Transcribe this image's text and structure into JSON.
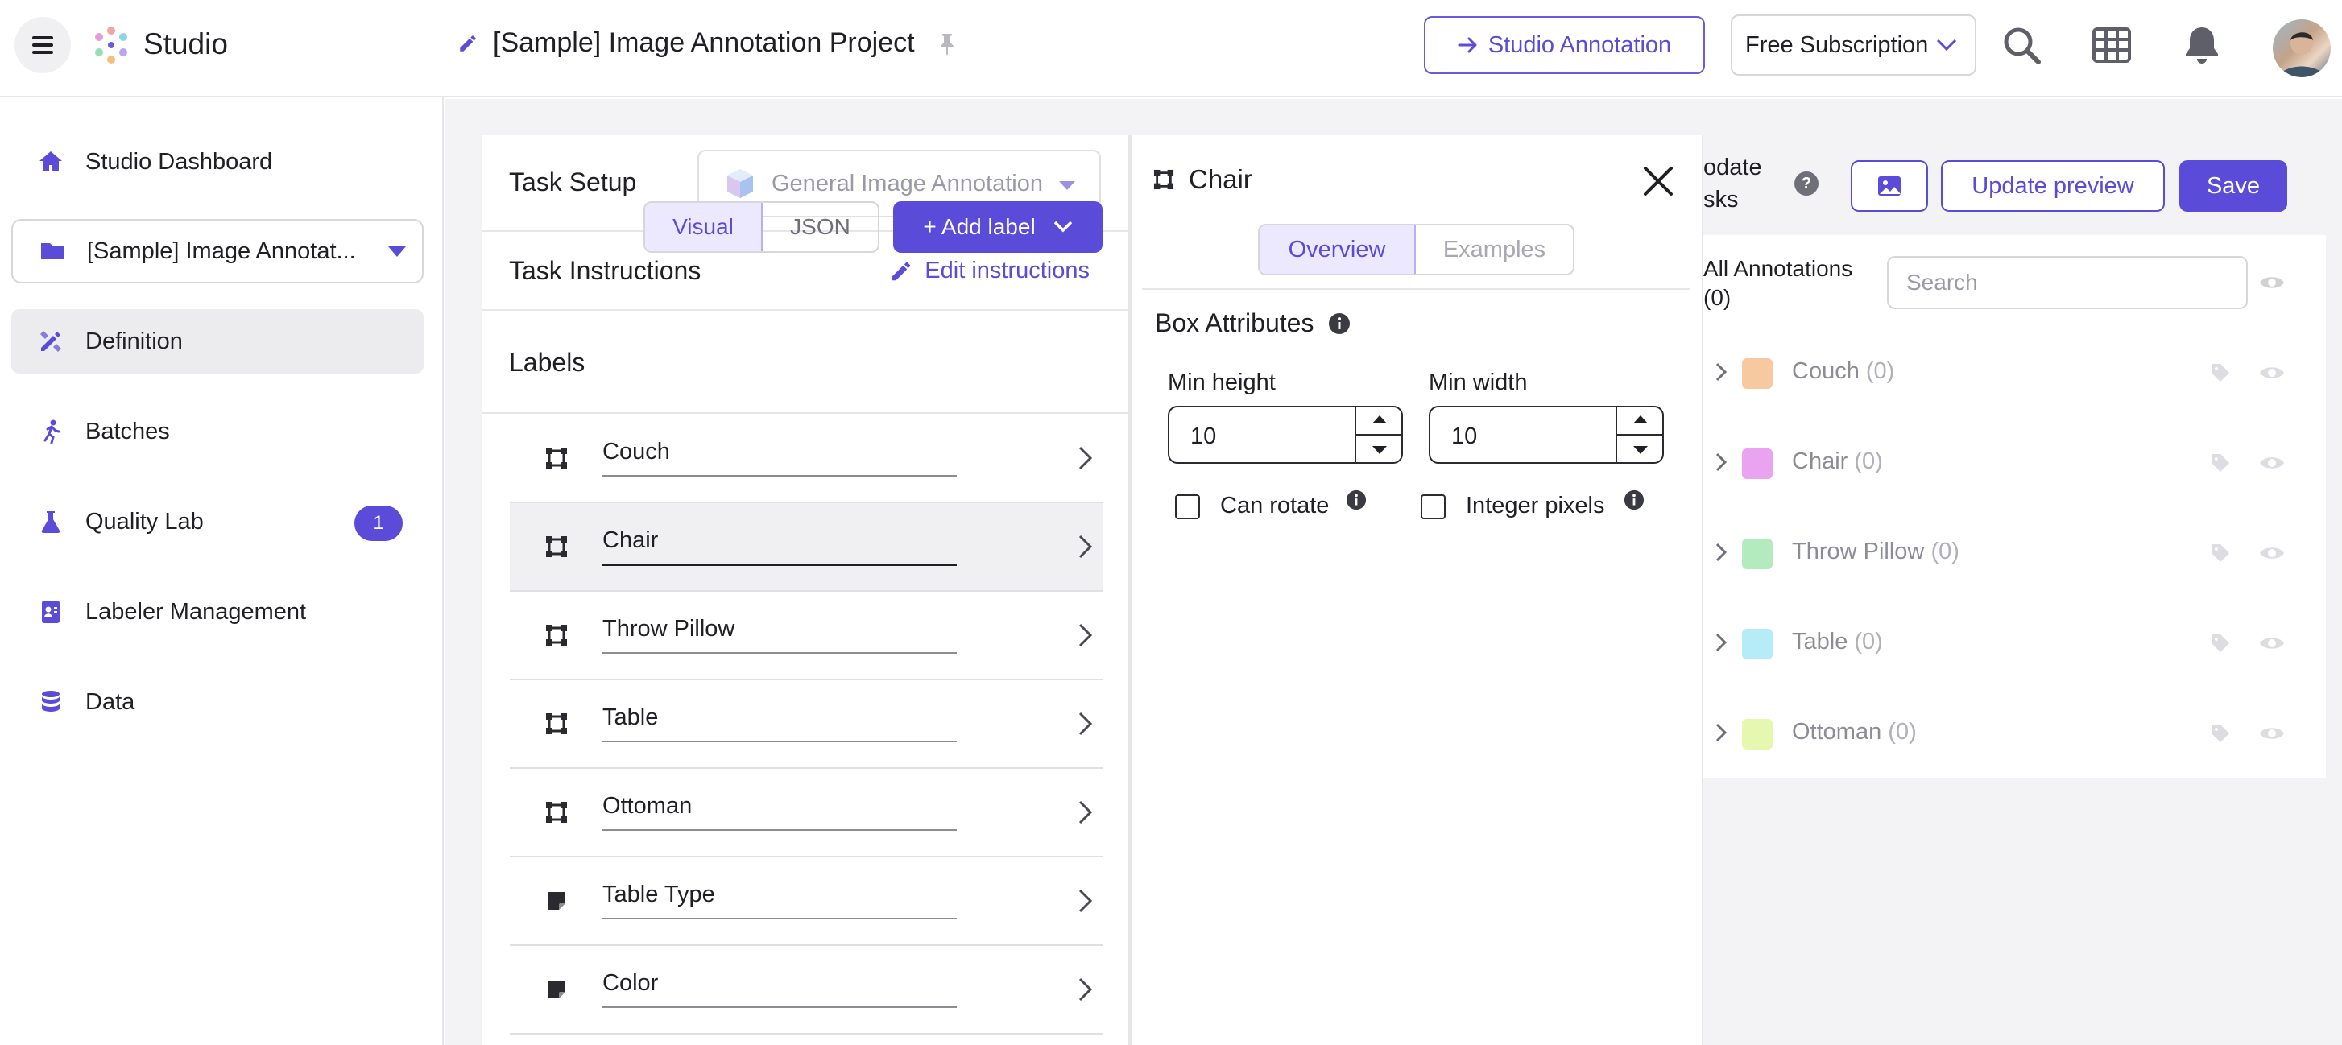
{
  "app": {
    "name": "Studio"
  },
  "project": {
    "title": "[Sample] Image Annotation Project"
  },
  "header": {
    "studio_annotation_label": "Studio Annotation",
    "subscription_label": "Free Subscription"
  },
  "sidebar": {
    "items": [
      {
        "label": "Studio Dashboard",
        "icon": "home-icon"
      },
      {
        "label": "[Sample] Image Annotat...",
        "icon": "folder-icon"
      },
      {
        "label": "Definition",
        "icon": "pen-ruler-icon"
      },
      {
        "label": "Batches",
        "icon": "runner-icon"
      },
      {
        "label": "Quality Lab",
        "icon": "flask-icon",
        "badge": "1"
      },
      {
        "label": "Labeler Management",
        "icon": "id-badge-icon"
      },
      {
        "label": "Data",
        "icon": "database-icon"
      }
    ]
  },
  "task_setup": {
    "heading": "Task Setup",
    "task_type": "General Image Annotation",
    "instructions_heading": "Task Instructions",
    "edit_instructions": "Edit instructions",
    "labels_heading": "Labels",
    "view_visual": "Visual",
    "view_json": "JSON",
    "add_label": "+ Add label",
    "labels": [
      {
        "name": "Couch",
        "icon": "box-icon"
      },
      {
        "name": "Chair",
        "icon": "box-icon",
        "selected": true
      },
      {
        "name": "Throw Pillow",
        "icon": "box-icon"
      },
      {
        "name": "Table",
        "icon": "box-icon"
      },
      {
        "name": "Ottoman",
        "icon": "box-icon"
      },
      {
        "name": "Table Type",
        "icon": "note-icon"
      },
      {
        "name": "Color",
        "icon": "note-icon"
      }
    ]
  },
  "detail": {
    "title": "Chair",
    "tab_overview": "Overview",
    "tab_examples": "Examples",
    "section_heading": "Box Attributes",
    "min_height_label": "Min height",
    "min_height_value": "10",
    "min_width_label": "Min width",
    "min_width_value": "10",
    "can_rotate_label": "Can rotate",
    "integer_pixels_label": "Integer pixels"
  },
  "preview": {
    "update_tasks_text_1": "odate",
    "update_tasks_text_2": "sks",
    "update_preview": "Update preview",
    "save": "Save",
    "all_annotations_label": "All Annotations",
    "all_annotations_count": "(0)",
    "search_placeholder": "Search",
    "annotations": [
      {
        "name": "Couch",
        "count": "(0)",
        "color": "#f7c9a0"
      },
      {
        "name": "Chair",
        "count": "(0)",
        "color": "#e9a3f0"
      },
      {
        "name": "Throw Pillow",
        "count": "(0)",
        "color": "#b4ebbe"
      },
      {
        "name": "Table",
        "count": "(0)",
        "color": "#b6ecf7"
      },
      {
        "name": "Ottoman",
        "count": "(0)",
        "color": "#e6f7b0"
      }
    ]
  },
  "colors": {
    "accent": "#5a4bd8",
    "accent_light": "#ece9ff"
  }
}
